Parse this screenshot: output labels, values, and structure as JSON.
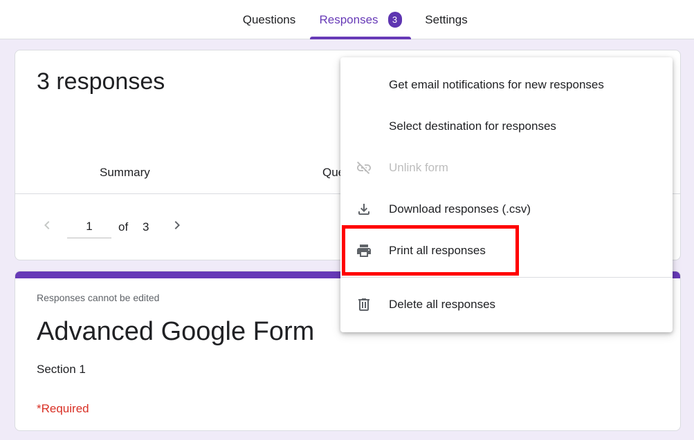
{
  "tabs": {
    "questions": "Questions",
    "responses": "Responses",
    "responses_badge": "3",
    "settings": "Settings"
  },
  "summary_card": {
    "title": "3 responses",
    "subtabs": {
      "summary": "Summary",
      "question": "Que"
    },
    "pager": {
      "current": "1",
      "of": "of",
      "total": "3"
    }
  },
  "form_card": {
    "notice": "Responses cannot be edited",
    "title": "Advanced Google Form",
    "section": "Section 1",
    "required": "*Required"
  },
  "menu": {
    "items": [
      {
        "label": "Get email notifications for new responses",
        "icon": "none",
        "enabled": true
      },
      {
        "label": "Select destination for responses",
        "icon": "none",
        "enabled": true
      },
      {
        "label": "Unlink form",
        "icon": "link-off-icon",
        "enabled": false
      },
      {
        "label": "Download responses (.csv)",
        "icon": "download-icon",
        "enabled": true
      },
      {
        "label": "Print all responses",
        "icon": "print-icon",
        "enabled": true,
        "highlighted": true
      },
      {
        "label": "Delete all responses",
        "icon": "trash-icon",
        "enabled": true
      }
    ]
  },
  "colors": {
    "accent": "#673ab7",
    "background": "#f0ebf8",
    "required": "#d93025",
    "highlight": "#ff0000"
  }
}
